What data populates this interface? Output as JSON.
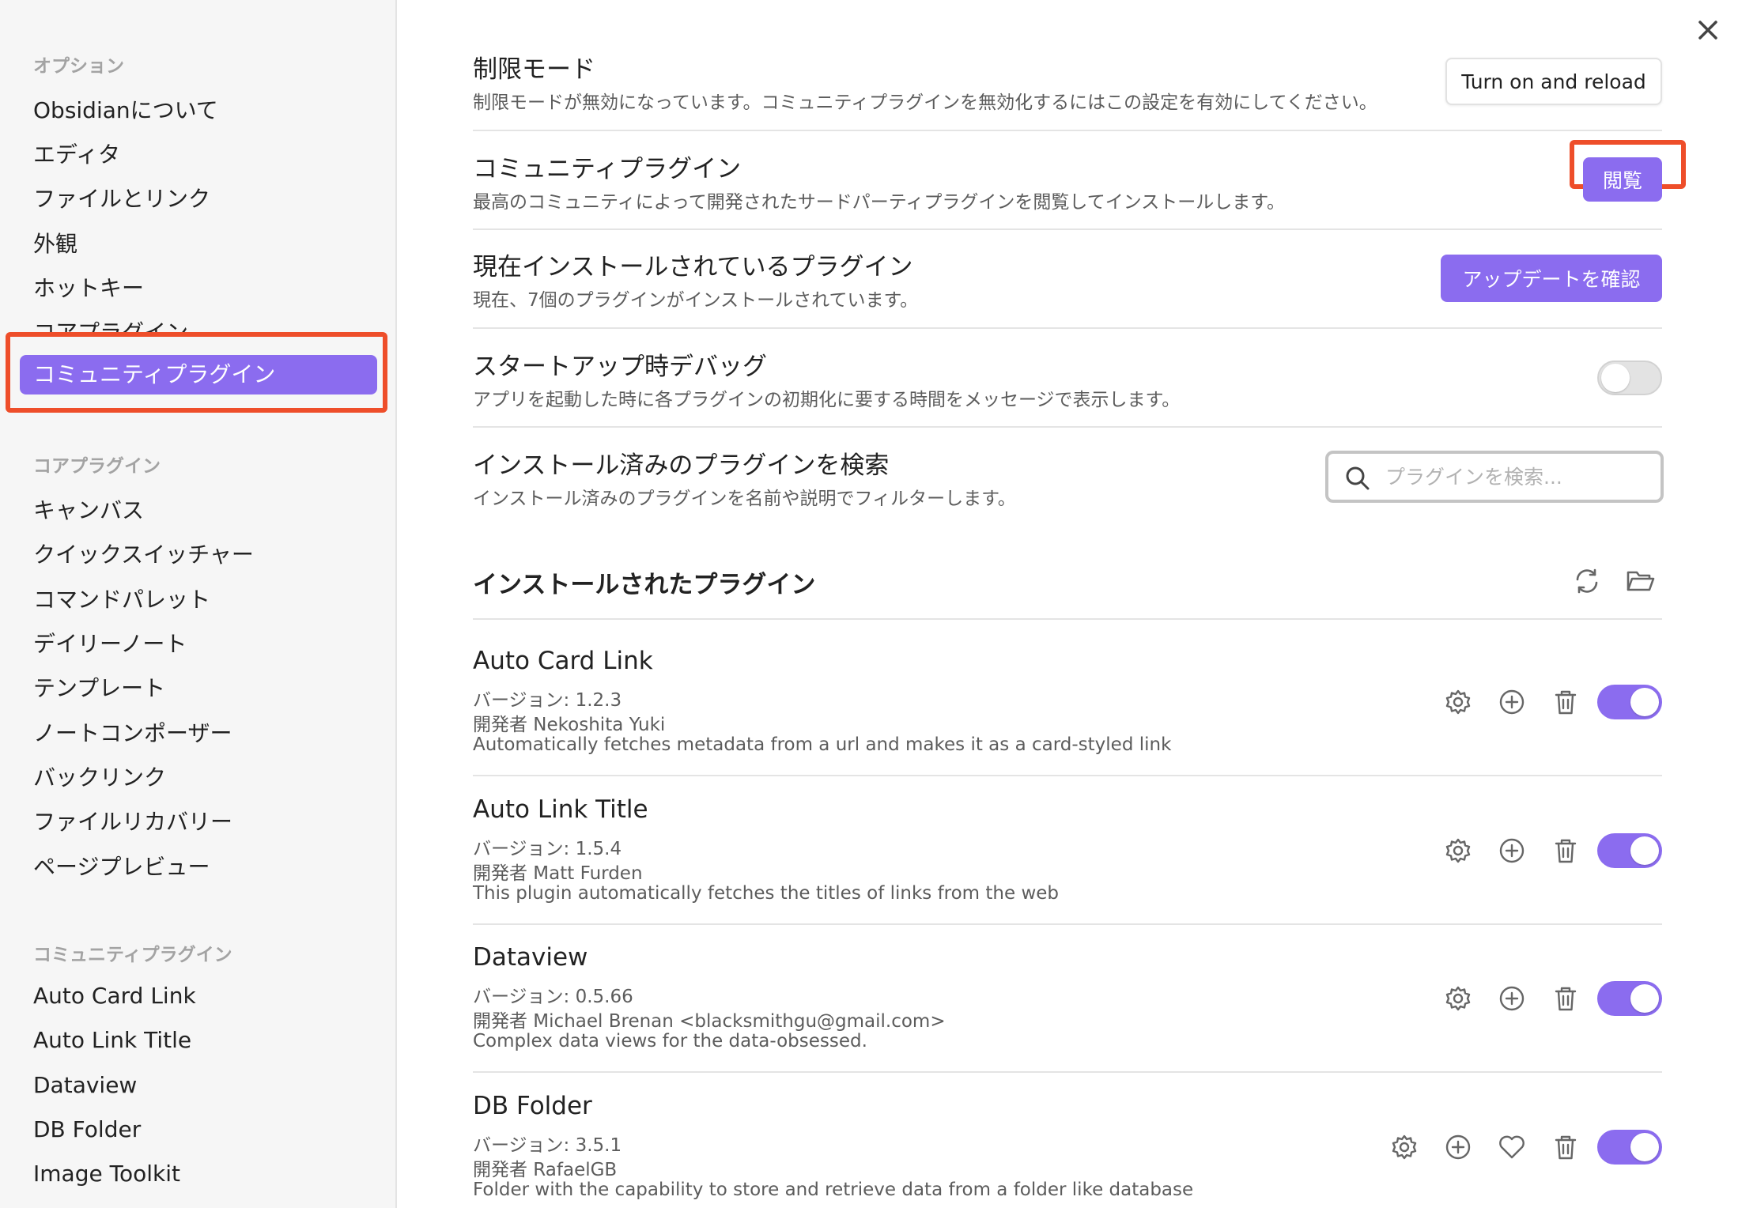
{
  "sidebar": {
    "options_title": "オプション",
    "options_items": [
      "Obsidianについて",
      "エディタ",
      "ファイルとリンク",
      "外観",
      "ホットキー",
      "コアプラグイン"
    ],
    "active_item": "コミュニティプラグイン",
    "core_title": "コアプラグイン",
    "core_items": [
      "キャンバス",
      "クイックスイッチャー",
      "コマンドパレット",
      "デイリーノート",
      "テンプレート",
      "ノートコンポーザー",
      "バックリンク",
      "ファイルリカバリー",
      "ページプレビュー"
    ],
    "community_title": "コミュニティプラグイン",
    "community_items": [
      "Auto Card Link",
      "Auto Link Title",
      "Dataview",
      "DB Folder",
      "Image Toolkit"
    ]
  },
  "settings": {
    "restricted": {
      "name": "制限モード",
      "desc": "制限モードが無効になっています。コミュニティプラグインを無効化するにはこの設定を有効にしてください。",
      "button": "Turn on and reload"
    },
    "community": {
      "name": "コミュニティプラグイン",
      "desc": "最高のコミュニティによって開発されたサードパーティプラグインを閲覧してインストールします。",
      "button": "閲覧"
    },
    "installed": {
      "name": "現在インストールされているプラグイン",
      "desc": "現在、7個のプラグインがインストールされています。",
      "button": "アップデートを確認"
    },
    "debug": {
      "name": "スタートアップ時デバッグ",
      "desc": "アプリを起動した時に各プラグインの初期化に要する時間をメッセージで表示します。",
      "enabled": false
    },
    "search": {
      "name": "インストール済みのプラグインを検索",
      "desc": "インストール済みのプラグインを名前や説明でフィルターします。",
      "placeholder": "プラグインを検索..."
    }
  },
  "installed_heading": "インストールされたプラグイン",
  "plugins": [
    {
      "name": "Auto Card Link",
      "version": "バージョン: 1.2.3",
      "author": "開発者 Nekoshita Yuki",
      "desc": "Automatically fetches metadata from a url and makes it as a card-styled link",
      "enabled": true
    },
    {
      "name": "Auto Link Title",
      "version": "バージョン: 1.5.4",
      "author": "開発者 Matt Furden",
      "desc": "This plugin automatically fetches the titles of links from the web",
      "enabled": true
    },
    {
      "name": "Dataview",
      "version": "バージョン: 0.5.66",
      "author": "開発者 Michael Brenan <blacksmithgu@gmail.com>",
      "desc": "Complex data views for the data-obsessed.",
      "enabled": true
    },
    {
      "name": "DB Folder",
      "version": "バージョン: 3.5.1",
      "author": "開発者 RafaelGB",
      "desc": "Folder with the capability to store and retrieve data from a folder like database",
      "enabled": true
    }
  ],
  "colors": {
    "accent": "#8b6cef",
    "highlight": "#ee4e2a"
  },
  "icons": [
    "close-icon",
    "search-icon",
    "reload-icon",
    "folder-open-icon",
    "gear-icon",
    "plus-circle-icon",
    "heart-icon",
    "trash-icon"
  ]
}
